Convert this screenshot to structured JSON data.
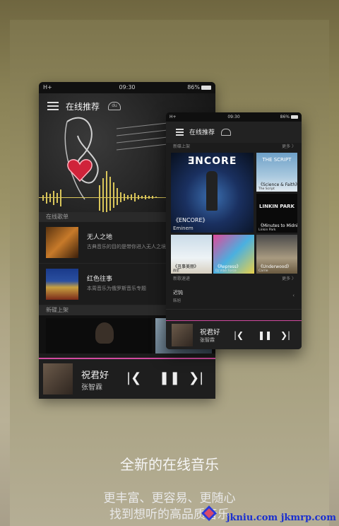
{
  "big_phone": {
    "status": {
      "signal": "H+",
      "time": "09:30",
      "battery": "86%"
    },
    "header": {
      "title": "在线推荐",
      "logo": "du"
    },
    "section_online_playlists": "在线歌单",
    "playlists": [
      {
        "title": "无人之地",
        "desc": "古典音乐的目的是带你进入无人之境"
      },
      {
        "title": "红色往事",
        "desc": "本周音乐为俄罗斯音乐专题"
      }
    ],
    "section_new_discs": "新碟上架",
    "player": {
      "title": "祝君好",
      "artist": "张智霖"
    }
  },
  "small_phone": {
    "status": {
      "signal": "H+",
      "time": "09:30",
      "battery": "86%"
    },
    "header": {
      "title": "在线推荐"
    },
    "section_new_discs": "新碟上架",
    "more_label": "更多 〉",
    "albums": [
      {
        "title": "《ENCORE》",
        "artist": "Eminem",
        "cover_text": "ƎNCORE"
      },
      {
        "title": "《Science & Faith》",
        "artist": "The Script",
        "cover_text": "THE SCRIPT"
      },
      {
        "title": "《Minutes to Midnight》",
        "artist": "Linkin Park",
        "cover_text": "LINKIN PARK"
      },
      {
        "title": "《丑事美丽》",
        "artist": "群星"
      },
      {
        "title": "《Repress》",
        "artist": "DJ Vibe Force"
      },
      {
        "title": "《Underwood》",
        "artist": "Carrie"
      }
    ],
    "section_new_songs": "新歌速递",
    "more_label2": "更多 〉",
    "song": {
      "title": "迟钝",
      "artist": "韩旭"
    },
    "player": {
      "title": "祝君好",
      "artist": "张智霖"
    }
  },
  "captions": {
    "main": "全新的在线音乐",
    "line1": "更丰富、更容易、更随心",
    "line2": "找到想听的高品质音乐"
  },
  "watermark": "jkniu.com jkmrp.com"
}
